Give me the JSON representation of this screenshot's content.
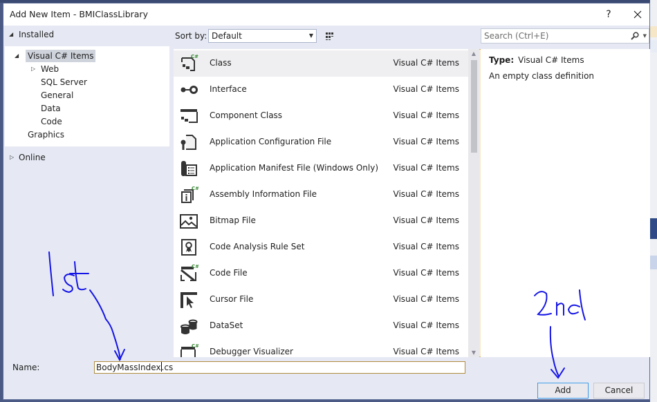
{
  "window": {
    "title": "Add New Item - BMIClassLibrary",
    "help_label": "?",
    "close_label": "✕"
  },
  "tree": {
    "installed_label": "Installed",
    "items": [
      {
        "label": "Visual C# Items",
        "expanded": true,
        "selected": true
      },
      {
        "label": "Web",
        "collapsed": true
      },
      {
        "label": "SQL Server"
      },
      {
        "label": "General"
      },
      {
        "label": "Data"
      },
      {
        "label": "Code"
      },
      {
        "label": "Graphics"
      }
    ],
    "online_label": "Online"
  },
  "toolbar": {
    "sort_label": "Sort by:",
    "sort_value": "Default",
    "search_placeholder": "Search (Ctrl+E)"
  },
  "templates": [
    {
      "name": "Class",
      "category": "Visual C# Items",
      "icon": "class-icon",
      "selected": true
    },
    {
      "name": "Interface",
      "category": "Visual C# Items",
      "icon": "interface-icon"
    },
    {
      "name": "Component Class",
      "category": "Visual C# Items",
      "icon": "component-class-icon"
    },
    {
      "name": "Application Configuration File",
      "category": "Visual C# Items",
      "icon": "config-file-icon"
    },
    {
      "name": "Application Manifest File (Windows Only)",
      "category": "Visual C# Items",
      "icon": "manifest-file-icon"
    },
    {
      "name": "Assembly Information File",
      "category": "Visual C# Items",
      "icon": "assembly-info-icon"
    },
    {
      "name": "Bitmap File",
      "category": "Visual C# Items",
      "icon": "bitmap-icon"
    },
    {
      "name": "Code Analysis Rule Set",
      "category": "Visual C# Items",
      "icon": "rule-set-icon"
    },
    {
      "name": "Code File",
      "category": "Visual C# Items",
      "icon": "code-file-icon"
    },
    {
      "name": "Cursor File",
      "category": "Visual C# Items",
      "icon": "cursor-file-icon"
    },
    {
      "name": "DataSet",
      "category": "Visual C# Items",
      "icon": "dataset-icon"
    },
    {
      "name": "Debugger Visualizer",
      "category": "Visual C# Items",
      "icon": "debugger-visualizer-icon"
    }
  ],
  "details": {
    "type_label": "Type:",
    "type_value": "Visual C# Items",
    "description": "An empty class definition"
  },
  "footer": {
    "name_label": "Name:",
    "name_value_before_caret": "BodyMassIndex",
    "name_value_after_caret": ".cs",
    "add_label": "Add",
    "cancel_label": "Cancel"
  },
  "annotations": {
    "first": "1st",
    "second": "2nd",
    "color": "#1414e6"
  }
}
